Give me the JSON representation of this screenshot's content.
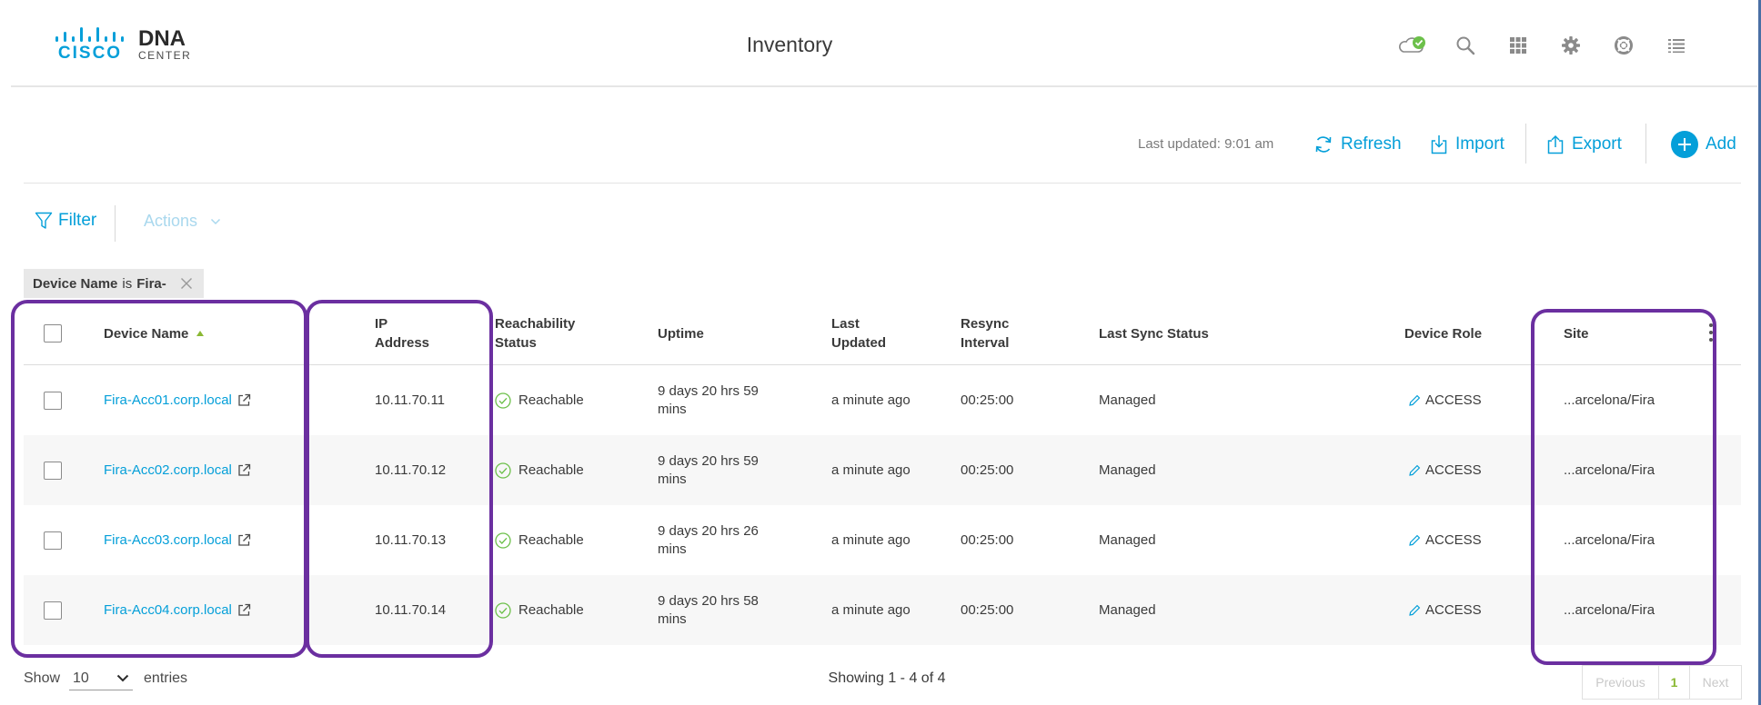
{
  "header": {
    "brand": "CISCO",
    "product": "DNA",
    "product_sub": "CENTER",
    "title": "Inventory",
    "icons": [
      "cloud-status-icon",
      "search-icon",
      "apps-grid-icon",
      "gear-icon",
      "help-icon",
      "tasks-list-icon"
    ]
  },
  "toolbar": {
    "last_updated": "Last updated: 9:01 am",
    "refresh_label": "Refresh",
    "import_label": "Import",
    "export_label": "Export",
    "add_label": "Add"
  },
  "filters": {
    "filter_label": "Filter",
    "actions_label": "Actions",
    "chip": {
      "field": "Device Name",
      "operator": "is",
      "value": "Fira-"
    }
  },
  "table": {
    "columns": {
      "device_name": "Device Name",
      "ip_line1": "IP",
      "ip_line2": "Address",
      "reach_line1": "Reachability",
      "reach_line2": "Status",
      "uptime": "Uptime",
      "last_updated_line1": "Last",
      "last_updated_line2": "Updated",
      "resync_line1": "Resync",
      "resync_line2": "Interval",
      "last_sync_status": "Last Sync Status",
      "device_role": "Device Role",
      "site": "Site"
    },
    "rows": [
      {
        "device_name": "Fira-Acc01.corp.local",
        "ip": "10.11.70.11",
        "reachability": "Reachable",
        "uptime_line1": "9 days 20 hrs 59",
        "uptime_line2": "mins",
        "last_updated": "a minute ago",
        "resync": "00:25:00",
        "sync_status": "Managed",
        "role": "ACCESS",
        "site": "...arcelona/Fira"
      },
      {
        "device_name": "Fira-Acc02.corp.local",
        "ip": "10.11.70.12",
        "reachability": "Reachable",
        "uptime_line1": "9 days 20 hrs 59",
        "uptime_line2": "mins",
        "last_updated": "a minute ago",
        "resync": "00:25:00",
        "sync_status": "Managed",
        "role": "ACCESS",
        "site": "...arcelona/Fira"
      },
      {
        "device_name": "Fira-Acc03.corp.local",
        "ip": "10.11.70.13",
        "reachability": "Reachable",
        "uptime_line1": "9 days 20 hrs 26",
        "uptime_line2": "mins",
        "last_updated": "a minute ago",
        "resync": "00:25:00",
        "sync_status": "Managed",
        "role": "ACCESS",
        "site": "...arcelona/Fira"
      },
      {
        "device_name": "Fira-Acc04.corp.local",
        "ip": "10.11.70.14",
        "reachability": "Reachable",
        "uptime_line1": "9 days 20 hrs 58",
        "uptime_line2": "mins",
        "last_updated": "a minute ago",
        "resync": "00:25:00",
        "sync_status": "Managed",
        "role": "ACCESS",
        "site": "...arcelona/Fira"
      }
    ]
  },
  "footer": {
    "show_label": "Show",
    "entries_value": "10",
    "entries_label": "entries",
    "showing": "Showing 1 - 4 of 4",
    "previous": "Previous",
    "page": "1",
    "next": "Next"
  },
  "colors": {
    "accent": "#049fd9",
    "highlight_box": "#6b2fa0",
    "reachable": "#6cc04a"
  }
}
